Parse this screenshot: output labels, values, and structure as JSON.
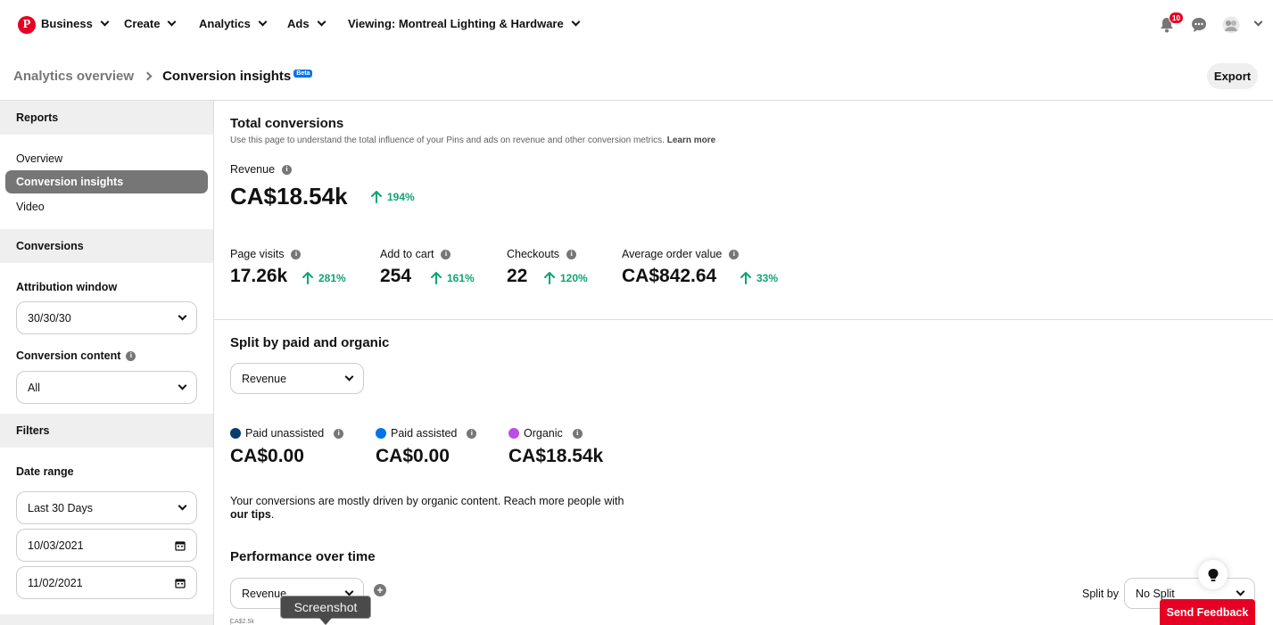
{
  "nav": {
    "items": [
      "Business",
      "Create",
      "Analytics",
      "Ads",
      "Viewing: Montreal Lighting & Hardware"
    ],
    "notification_count": "10",
    "icons": [
      "pinterest-logo",
      "bell-icon",
      "chat-icon",
      "avatar",
      "chevron-down-icon"
    ],
    "brand_color": "#e60023"
  },
  "header": {
    "breadcrumb_parent": "Analytics overview",
    "breadcrumb_current": "Conversion insights",
    "beta_badge": "Beta",
    "export_label": "Export"
  },
  "sidebar": {
    "reports_heading": "Reports",
    "report_links": [
      "Overview",
      "Conversion insights",
      "Video"
    ],
    "active_report": "Conversion insights",
    "conversions_heading": "Conversions",
    "attribution_label": "Attribution window",
    "attribution_value": "30/30/30",
    "content_label": "Conversion content",
    "content_value": "All",
    "filters_heading": "Filters",
    "date_range_label": "Date range",
    "date_range_value": "Last 30 Days",
    "start_date": "10/03/2021",
    "end_date": "11/02/2021"
  },
  "total": {
    "title": "Total conversions",
    "subtitle": "Use this page to understand the total influence of your Pins and ads on revenue and other conversion metrics.",
    "learn_more": "Learn more",
    "revenue_label": "Revenue",
    "revenue_value": "CA$18.54k",
    "revenue_delta": "194%",
    "metrics": [
      {
        "label": "Page visits",
        "value": "17.26k",
        "delta": "281%"
      },
      {
        "label": "Add to cart",
        "value": "254",
        "delta": "161%"
      },
      {
        "label": "Checkouts",
        "value": "22",
        "delta": "120%"
      },
      {
        "label": "Average order value",
        "value": "CA$842.64",
        "delta": "33%"
      }
    ],
    "delta_color": "#0fa573"
  },
  "split": {
    "title": "Split by paid and organic",
    "metric_select": "Revenue",
    "items": [
      {
        "label": "Paid unassisted",
        "value": "CA$0.00",
        "color": "#0b3b6b"
      },
      {
        "label": "Paid assisted",
        "value": "CA$0.00",
        "color": "#0074e8"
      },
      {
        "label": "Organic",
        "value": "CA$18.54k",
        "color": "#b84de8"
      }
    ],
    "note": "Your conversions are mostly driven by organic content. Reach more people with",
    "note_link": "our tips",
    "note_end": "."
  },
  "performance": {
    "title": "Performance over time",
    "metric_select": "Revenue",
    "split_by_label": "Split by",
    "split_by_value": "No Split",
    "axis_stub": "CA$2.5k"
  },
  "overlay": {
    "feedback_label": "Send Feedback",
    "tooltip": "Screenshot"
  }
}
